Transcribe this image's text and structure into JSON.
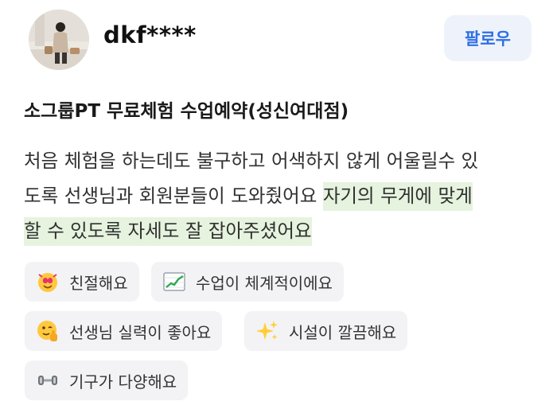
{
  "profile": {
    "username": "dkf****",
    "follow_label": "팔로우"
  },
  "review": {
    "title": "소그룹PT 무료체험 수업예약(성신여대점)",
    "line1": "처음 체험을 하는데도 불구하고 어색하지 않게 어울릴수 있",
    "line2_plain": "도록 선생님과 회원분들이 도와줬어요 ",
    "line2_highlight": "자기의 무게에 맞게",
    "line3_highlight": "할 수 있도록 자세도 잘 잡아주셨어요"
  },
  "tags": [
    {
      "icon": "heart-face-icon",
      "label": "친절해요"
    },
    {
      "icon": "chart-up-icon",
      "label": "수업이 체계적이에요"
    },
    {
      "icon": "thumbs-up-face-icon",
      "label": "선생님 실력이 좋아요"
    },
    {
      "icon": "sparkles-icon",
      "label": "시설이 깔끔해요"
    },
    {
      "icon": "dumbbell-icon",
      "label": "기구가 다양해요"
    }
  ],
  "colors": {
    "follow_text": "#2f6fe6",
    "follow_bg": "#eef3fb",
    "highlight_bg": "#e6f3df",
    "chip_bg": "#f3f3f5"
  }
}
